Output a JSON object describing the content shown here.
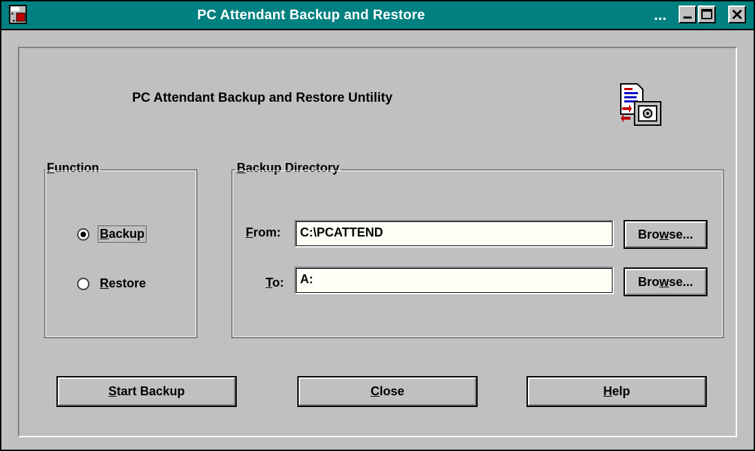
{
  "window": {
    "title": "PC Attendant Backup and Restore",
    "title_ellipsis": "...",
    "titlebar_color": "#008080"
  },
  "heading": "PC Attendant Backup and Restore Untility",
  "function_group": {
    "label_mnemonic": "F",
    "label_rest": "unction",
    "options": [
      {
        "mnemonic": "B",
        "rest": "ackup",
        "selected": true
      },
      {
        "mnemonic": "R",
        "rest": "estore",
        "selected": false
      }
    ]
  },
  "directory_group": {
    "label_mnemonic": "B",
    "label_rest": "ackup Directory",
    "from": {
      "label_mnemonic": "F",
      "label_rest": "rom:",
      "value": "C:\\PCATTEND"
    },
    "to": {
      "label_mnemonic": "T",
      "label_rest": "o:",
      "value": "A:"
    },
    "browse": {
      "pre": "Bro",
      "mnemonic": "w",
      "post": "se..."
    }
  },
  "buttons": {
    "start": {
      "mnemonic": "S",
      "rest": "tart Backup"
    },
    "close": {
      "mnemonic": "C",
      "rest": "lose"
    },
    "help": {
      "mnemonic": "H",
      "rest": "elp"
    }
  },
  "icons": [
    "system-menu-icon",
    "minimize-icon",
    "maximize-icon",
    "close-icon",
    "backup-restore-app-icon"
  ]
}
